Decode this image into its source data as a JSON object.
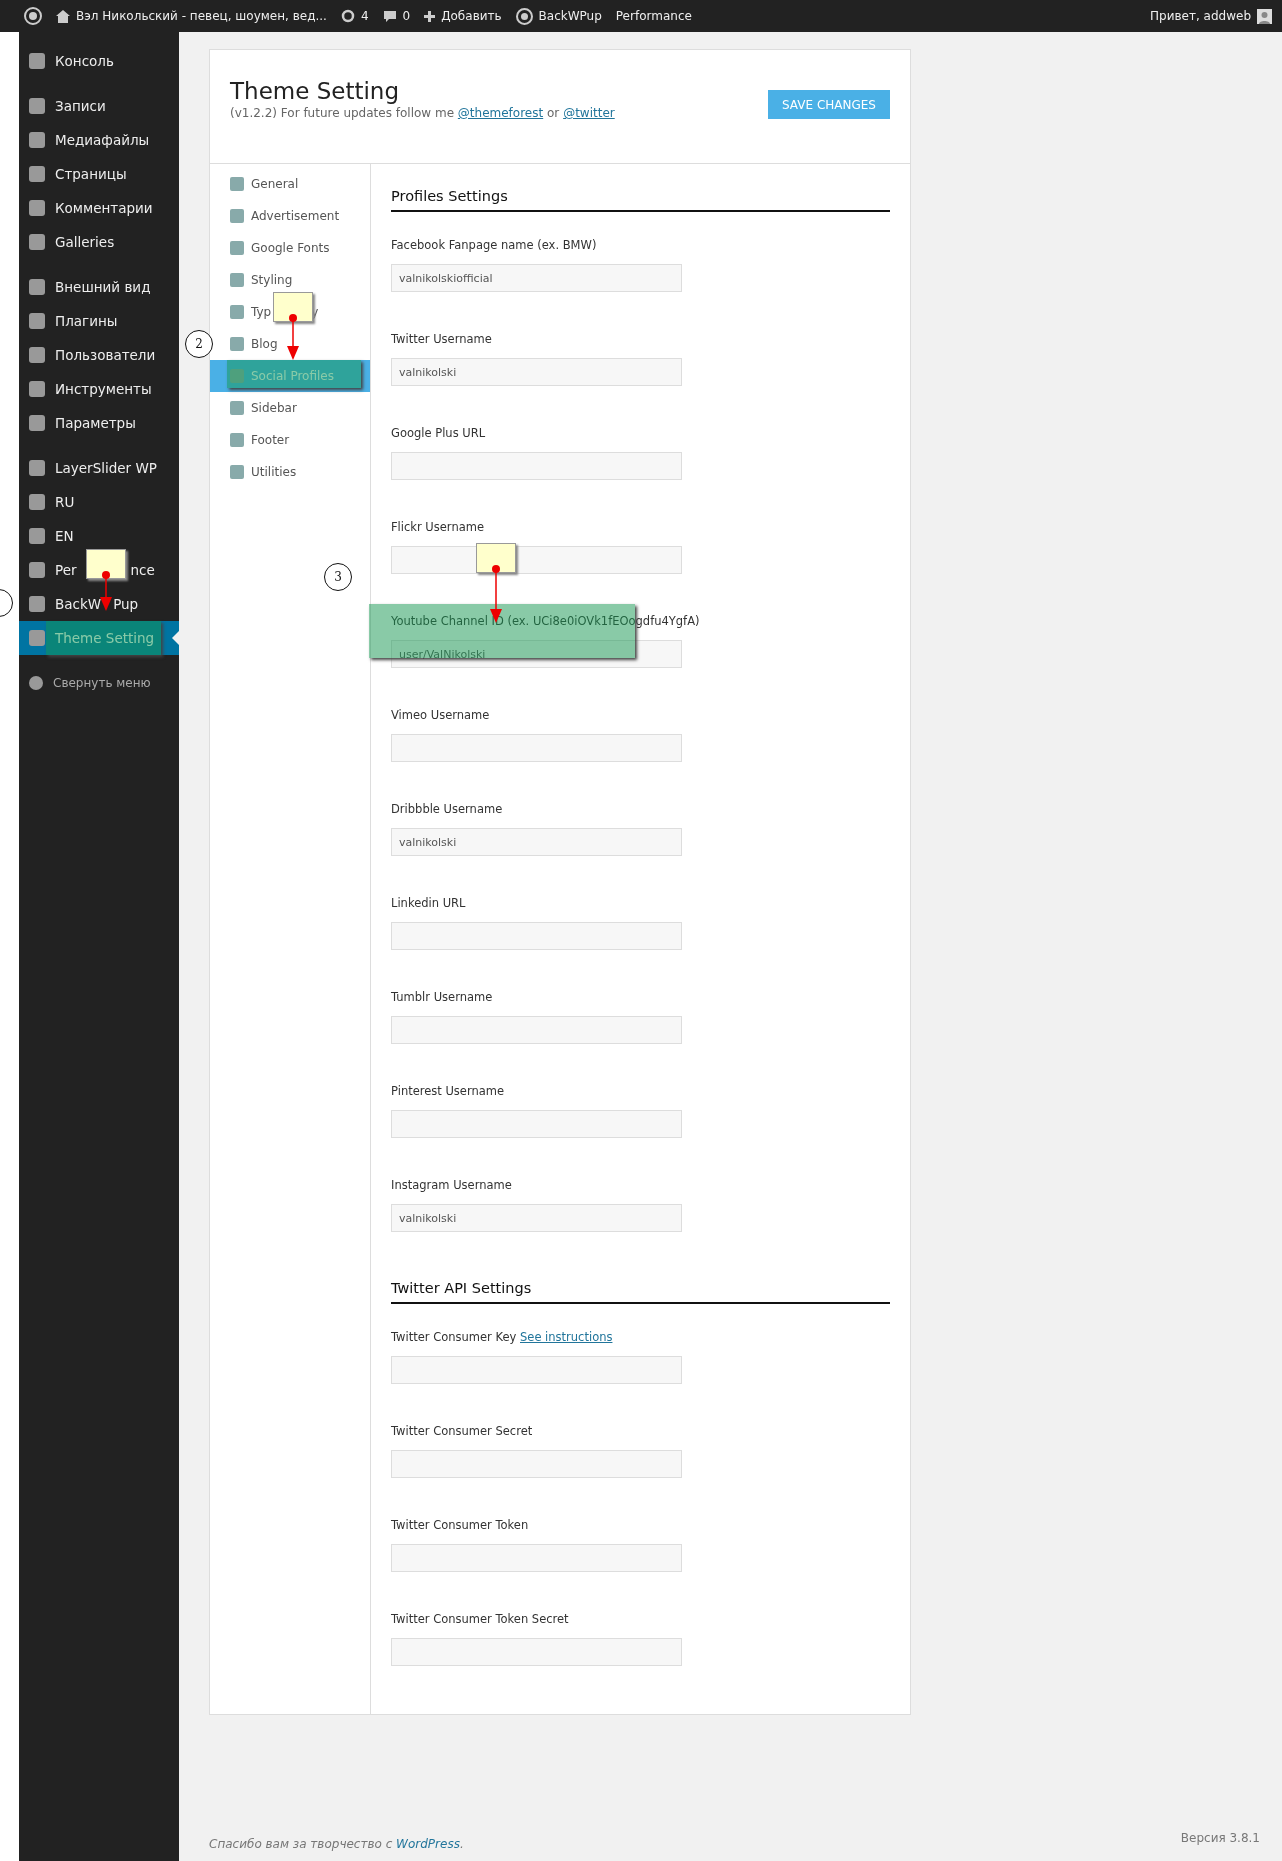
{
  "admin_bar": {
    "site_title": "Вэл Никольский - певец, шоумен, вед...",
    "updates_count": "4",
    "comments_count": "0",
    "new_label": "Добавить",
    "plugin_label": "BackWPup",
    "performance_label": "Performance",
    "greeting": "Привет, addweb"
  },
  "sidebar": {
    "groups": [
      [
        {
          "label": "Консоль",
          "selected": false
        }
      ],
      [
        {
          "label": "Записи",
          "selected": false
        },
        {
          "label": "Медиафайлы",
          "selected": false
        },
        {
          "label": "Страницы",
          "selected": false
        },
        {
          "label": "Комментарии",
          "selected": false
        },
        {
          "label": "Galleries",
          "selected": false
        }
      ],
      [
        {
          "label": "Внешний вид",
          "selected": false
        },
        {
          "label": "Плагины",
          "selected": false
        },
        {
          "label": "Пользователи",
          "selected": false
        },
        {
          "label": "Инструменты",
          "selected": false
        },
        {
          "label": "Параметры",
          "selected": false
        }
      ],
      [
        {
          "label": "LayerSlider WP",
          "selected": false
        },
        {
          "label": "RU",
          "selected": false
        },
        {
          "label": "EN",
          "selected": false
        },
        {
          "label": "Per",
          "label_tail": "nce",
          "note": true,
          "selected": false
        },
        {
          "label": "BackW",
          "label_tail": "Pup",
          "edge_marker": true,
          "selected": false
        },
        {
          "label": "Theme Setting",
          "highlighted": true,
          "selected": true
        }
      ]
    ],
    "collapse_label": "Свернуть меню"
  },
  "panel": {
    "title": "Theme Setting",
    "subtitle": "(v1.2.2) For future updates follow me",
    "link_1": "@themeforest",
    "joiner": "or",
    "link_2": "@twitter",
    "save_button": "SAVE CHANGES"
  },
  "menu": [
    {
      "label": "General",
      "selected": false
    },
    {
      "label": "Advertisement",
      "selected": false
    },
    {
      "label": "Google Fonts",
      "selected": false
    },
    {
      "label": "Styling",
      "selected": false
    },
    {
      "label": "Typ",
      "label_tail": "y",
      "note": true,
      "selected": false
    },
    {
      "label": "Blog",
      "step": "2",
      "selected": false
    },
    {
      "label": "Social Profiles",
      "highlighted": true,
      "selected": true
    },
    {
      "label": "Sidebar",
      "selected": false
    },
    {
      "label": "Footer",
      "selected": false
    },
    {
      "label": "Utilities",
      "selected": false
    }
  ],
  "sections": [
    {
      "title": "Profiles Settings",
      "fields": [
        {
          "label": "Facebook Fanpage name (ex. BMW)",
          "value": "valnikolskiofficial"
        },
        {
          "label": "Twitter Username",
          "value": "valnikolski"
        },
        {
          "label": "Google Plus URL"
        },
        {
          "label": "Flickr Username",
          "note": true
        },
        {
          "label": "Youtube Channel ID (ex. UCi8e0iOVk1fEOogdfu4YgfA)",
          "value": "user/ValNikolski",
          "highlighted": true,
          "step": "3"
        },
        {
          "label": "Vimeo Username"
        },
        {
          "label": "Dribbble Username",
          "value": "valnikolski"
        },
        {
          "label": "Linkedin URL"
        },
        {
          "label": "Tumblr Username"
        },
        {
          "label": "Pinterest Username"
        },
        {
          "label": "Instagram Username",
          "value": "valnikolski"
        }
      ]
    },
    {
      "title": "Twitter API Settings",
      "fields": [
        {
          "label": "Twitter Consumer Key",
          "link": "See instructions"
        },
        {
          "label": "Twitter Consumer Secret"
        },
        {
          "label": "Twitter Consumer Token"
        },
        {
          "label": "Twitter Consumer Token Secret"
        }
      ]
    }
  ],
  "footer": {
    "thanks": "Спасибо вам за творчество с",
    "link": "WordPress",
    "end": ".",
    "version": "Версия 3.8.1"
  }
}
